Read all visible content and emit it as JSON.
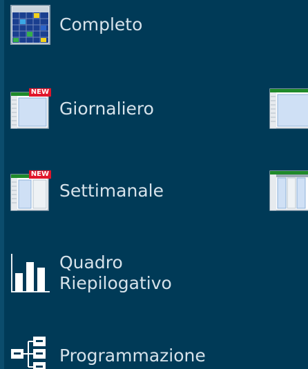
{
  "menu": {
    "items": [
      {
        "label": "Completo",
        "icon": "grid-calendar-icon"
      },
      {
        "label": "Giornaliero",
        "icon": "daily-sheet-icon",
        "badge": "NEW"
      },
      {
        "label": "Settimanale",
        "icon": "weekly-sheet-icon",
        "badge": "NEW"
      },
      {
        "label": "Quadro\nRiepilogativo",
        "icon": "bar-chart-icon"
      },
      {
        "label": "Programmazione",
        "icon": "schedule-tree-icon"
      }
    ]
  },
  "side_icons": [
    {
      "icon": "daily-sheet-icon"
    },
    {
      "icon": "weekly-sheet-icon"
    }
  ],
  "colors": {
    "background": "#003a57",
    "label": "#d6e2ea",
    "badge": "#e0162b",
    "sheet_header_green": "#1f8a2a"
  }
}
